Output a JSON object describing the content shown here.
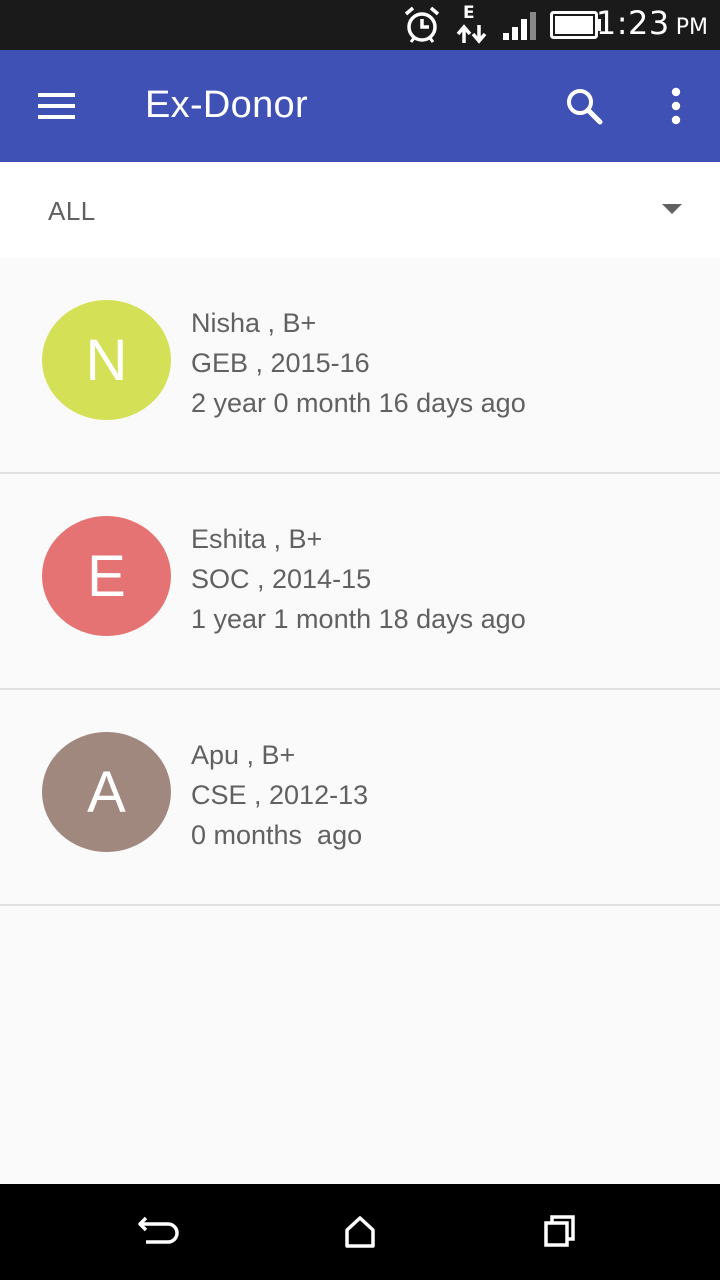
{
  "status_bar": {
    "network_type": "E",
    "time": "1:23",
    "ampm": "PM",
    "icons": [
      "alarm-icon",
      "data-transfer-icon",
      "signal-icon",
      "battery-icon"
    ]
  },
  "app_bar": {
    "title": "Ex-Donor",
    "background_color": "#3f51b5",
    "icons": [
      "menu-icon",
      "search-icon",
      "more-vert-icon"
    ]
  },
  "filter": {
    "selected": "ALL"
  },
  "donors": [
    {
      "initial": "N",
      "name_line": "Nisha , B+",
      "dept_line": "GEB , 2015-16",
      "time_line": "2 year 0 month 16 days ago",
      "avatar_color": "#d4e157"
    },
    {
      "initial": "E",
      "name_line": "Eshita , B+",
      "dept_line": "SOC , 2014-15",
      "time_line": "1 year 1 month 18 days ago",
      "avatar_color": "#e57373"
    },
    {
      "initial": "A",
      "name_line": "Apu , B+",
      "dept_line": "CSE , 2012-13",
      "time_line": "0 months  ago",
      "avatar_color": "#a1887f"
    }
  ],
  "nav_bar": {
    "icons": [
      "back-icon",
      "home-icon",
      "recents-icon"
    ]
  }
}
